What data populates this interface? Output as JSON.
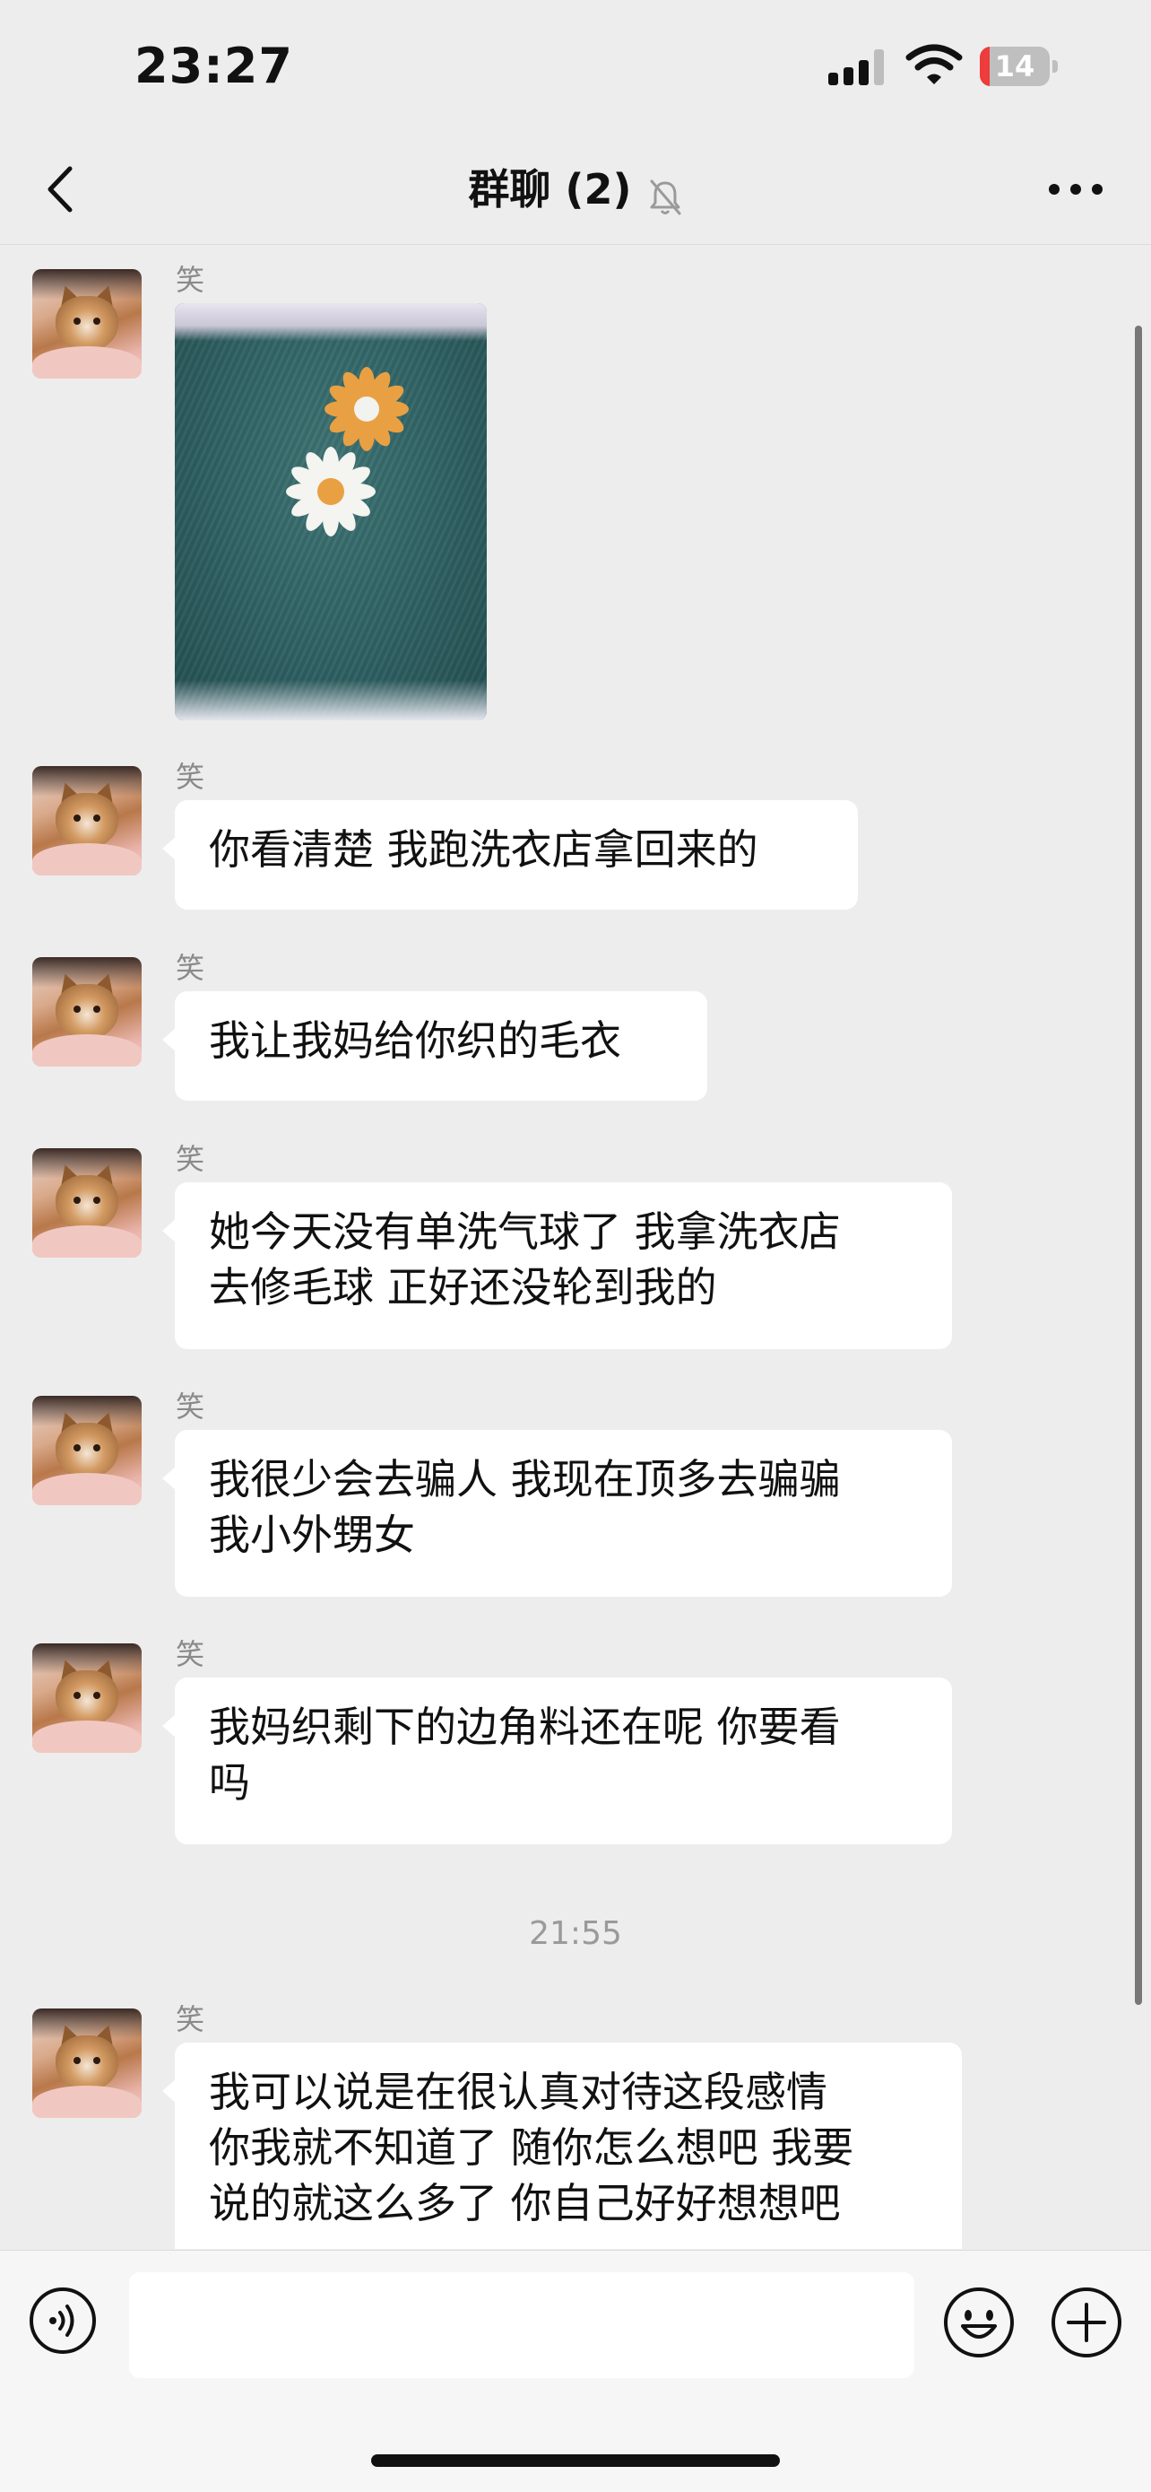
{
  "status_bar": {
    "time": "23:27",
    "battery_level": "14",
    "battery_fraction": 0.14,
    "battery_color": "#ee3b3b",
    "icons": [
      "signal-icon",
      "wifi-icon",
      "battery-icon"
    ]
  },
  "nav": {
    "title": "群聊 (2)",
    "back_icon": "chevron-left-icon",
    "mute_icon": "bell-muted-icon",
    "more_icon": "ellipsis-icon"
  },
  "messages": [
    {
      "sender": "笑",
      "type": "image",
      "image_desc_icon": "photo-thumbnail"
    },
    {
      "sender": "笑",
      "type": "text",
      "text": "你看清楚 我跑洗衣店拿回来的"
    },
    {
      "sender": "笑",
      "type": "text",
      "text": "我让我妈给你织的毛衣"
    },
    {
      "sender": "笑",
      "type": "text",
      "text": "她今天没有单洗气球了 我拿洗衣店\n去修毛球 正好还没轮到我的"
    },
    {
      "sender": "笑",
      "type": "text",
      "text": "我很少会去骗人 我现在顶多去骗骗\n我小外甥女"
    },
    {
      "sender": "笑",
      "type": "text",
      "text": "我妈织剩下的边角料还在呢 你要看\n吗"
    },
    {
      "sender": "笑",
      "type": "text",
      "text": "我可以说是在很认真对待这段感情\n你我就不知道了 随你怎么想吧 我要\n说的就这么多了 你自己好好想想吧"
    }
  ],
  "timestamp": "21:55",
  "input_bar": {
    "placeholder": "",
    "voice_icon": "voice-icon",
    "emoji_icon": "emoji-icon",
    "plus_icon": "plus-icon"
  },
  "colors": {
    "background": "#ededed",
    "bubble": "#ffffff",
    "text": "#111111",
    "sender": "#8a8a8a"
  }
}
